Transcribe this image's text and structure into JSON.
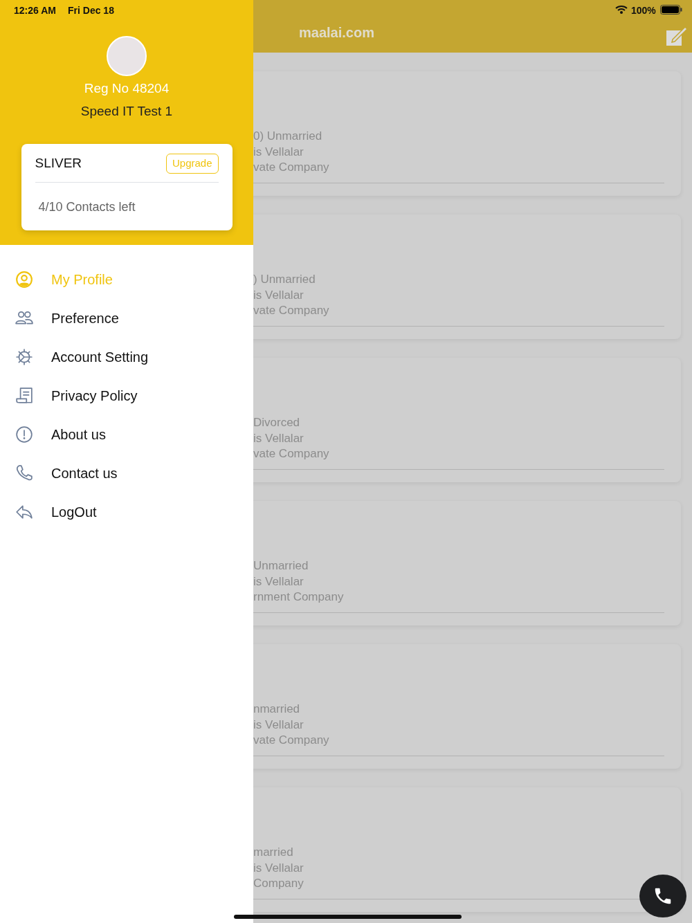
{
  "status_bar": {
    "time": "12:26 AM",
    "date": "Fri Dec 18",
    "battery": "100%"
  },
  "header": {
    "title": "maalai.com"
  },
  "profile": {
    "reg_no": "Reg No 48204",
    "name": "Speed IT Test 1"
  },
  "plan": {
    "name": "SLIVER",
    "upgrade": "Upgrade",
    "contacts": "4/10 Contacts left"
  },
  "menu": [
    {
      "label": "My Profile",
      "kind": "profile",
      "selected": true
    },
    {
      "label": "Preference",
      "kind": "people",
      "selected": false
    },
    {
      "label": "Account Setting",
      "kind": "gear",
      "selected": false
    },
    {
      "label": "Privacy Policy",
      "kind": "document",
      "selected": false
    },
    {
      "label": "About us",
      "kind": "info",
      "selected": false
    },
    {
      "label": "Contact us",
      "kind": "phone",
      "selected": false
    },
    {
      "label": "LogOut",
      "kind": "reply",
      "selected": false
    }
  ],
  "cards": [
    {
      "lines": [
        "0) Unmarried",
        "is Vellalar",
        "vate Company"
      ]
    },
    {
      "lines": [
        ") Unmarried",
        "is Vellalar",
        "vate Company"
      ]
    },
    {
      "lines": [
        "Divorced",
        "is Vellalar",
        "vate Company"
      ]
    },
    {
      "lines": [
        "Unmarried",
        "is Vellalar",
        "rnment Company"
      ]
    },
    {
      "lines": [
        "nmarried",
        "is Vellalar",
        "vate Company"
      ]
    },
    {
      "lines": [
        "married",
        "is Vellalar",
        "Company"
      ]
    }
  ]
}
